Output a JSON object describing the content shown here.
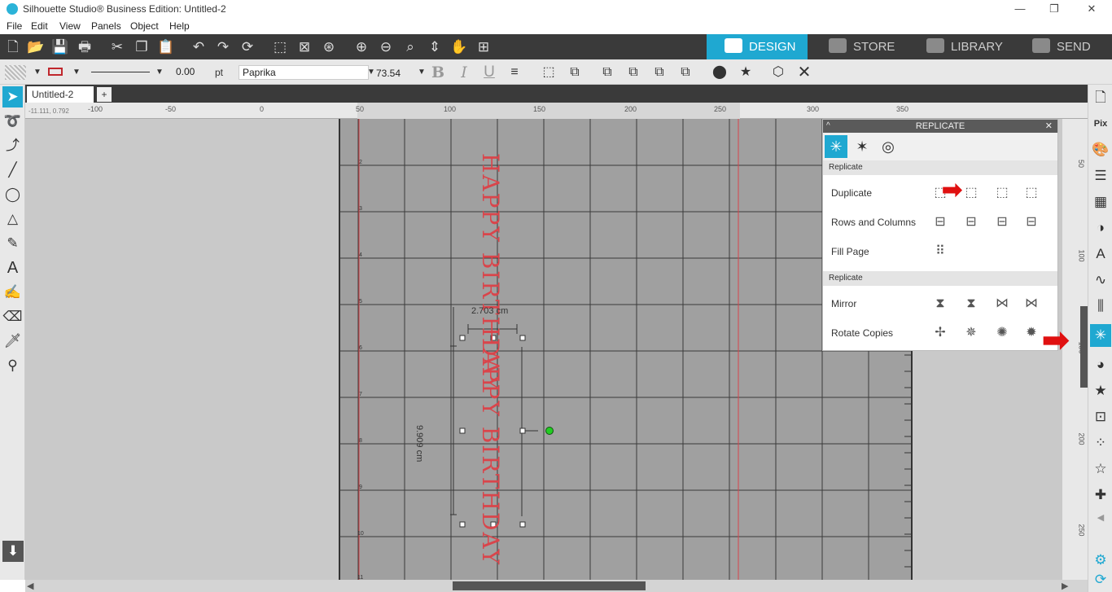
{
  "window": {
    "title": "Silhouette Studio® Business Edition: Untitled-2",
    "min": "—",
    "max": "❐",
    "close": "✕"
  },
  "menu": [
    "File",
    "Edit",
    "View",
    "Panels",
    "Object",
    "Help"
  ],
  "nav_tabs": [
    {
      "label": "DESIGN",
      "active": true
    },
    {
      "label": "STORE",
      "active": false
    },
    {
      "label": "LIBRARY",
      "active": false
    },
    {
      "label": "SEND",
      "active": false
    }
  ],
  "toolbar2": {
    "line_width": "0.00",
    "unit": "pt",
    "font": "Paprika",
    "font_size": "73.54",
    "bold": "B",
    "italic": "I",
    "underline": "U"
  },
  "doc_tab": {
    "name": "Untitled-2",
    "add": "+",
    "coords": "-11.111, 0.792"
  },
  "ruler_x": [
    "-100",
    "-50",
    "0",
    "50",
    "100",
    "150",
    "200",
    "250",
    "300",
    "350"
  ],
  "ruler_y": [
    "50",
    "100",
    "150",
    "200",
    "250"
  ],
  "canvas": {
    "text_main": "HAPPY BIRTHDAY",
    "text_copy": "HAPPY BIRTHDAY",
    "width_label": "2.703 cm",
    "height_label": "9.909 cm",
    "row_nums": [
      "2",
      "3",
      "4",
      "5",
      "6",
      "7",
      "8",
      "9",
      "10",
      "11"
    ]
  },
  "panel": {
    "title": "REPLICATE",
    "section1": "Replicate",
    "section2": "Replicate",
    "rows": [
      "Duplicate",
      "Rows and Columns",
      "Fill Page",
      "Mirror",
      "Rotate Copies"
    ]
  },
  "colors": {
    "accent": "#1fa8d1",
    "text_red": "#d9454b",
    "arrow": "#e01010"
  }
}
